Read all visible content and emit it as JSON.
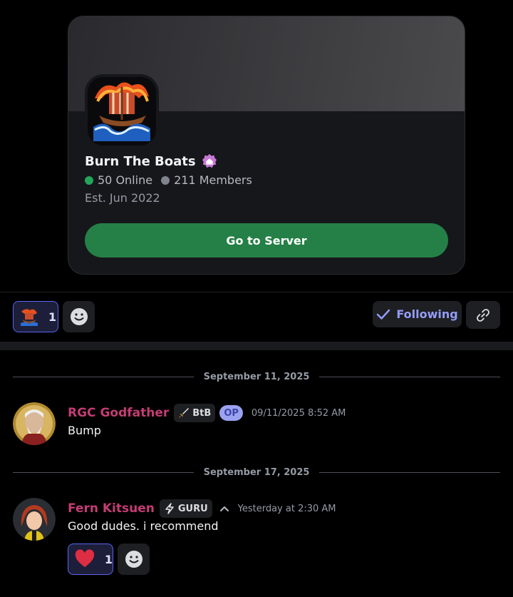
{
  "server_card": {
    "name": "Burn The Boats",
    "online": "50 Online",
    "members": "211 Members",
    "established": "Est. Jun 2022",
    "button_label": "Go to Server",
    "colors": {
      "button": "#248046",
      "online_dot": "#23a55a",
      "members_dot": "#80848e",
      "badge": "#c879d6"
    }
  },
  "actions": {
    "reaction_count": "1",
    "follow_label": "Following",
    "icons": [
      "server-emoji-reaction",
      "add-reaction-icon",
      "checkmark-icon",
      "link-icon"
    ]
  },
  "messages": [
    {
      "date_separator": "September 11, 2025",
      "username": "RGC Godfather",
      "tag": "BtB",
      "tag_icon": "sword-icon",
      "op_badge": "OP",
      "timestamp": "09/11/2025 8:52 AM",
      "text": "Bump"
    },
    {
      "date_separator": "September 17, 2025",
      "username": "Fern Kitsuen",
      "tag": "GURU",
      "tag_icon": "lightning-icon",
      "timestamp": "Yesterday at 2:30 AM",
      "text": "Good dudes. i recommend",
      "reaction": {
        "emoji": "heart",
        "count": "1"
      }
    }
  ],
  "theme": {
    "username_color": "#c33d73",
    "accent": "#5865f2",
    "follow_color": "#949cf7"
  }
}
